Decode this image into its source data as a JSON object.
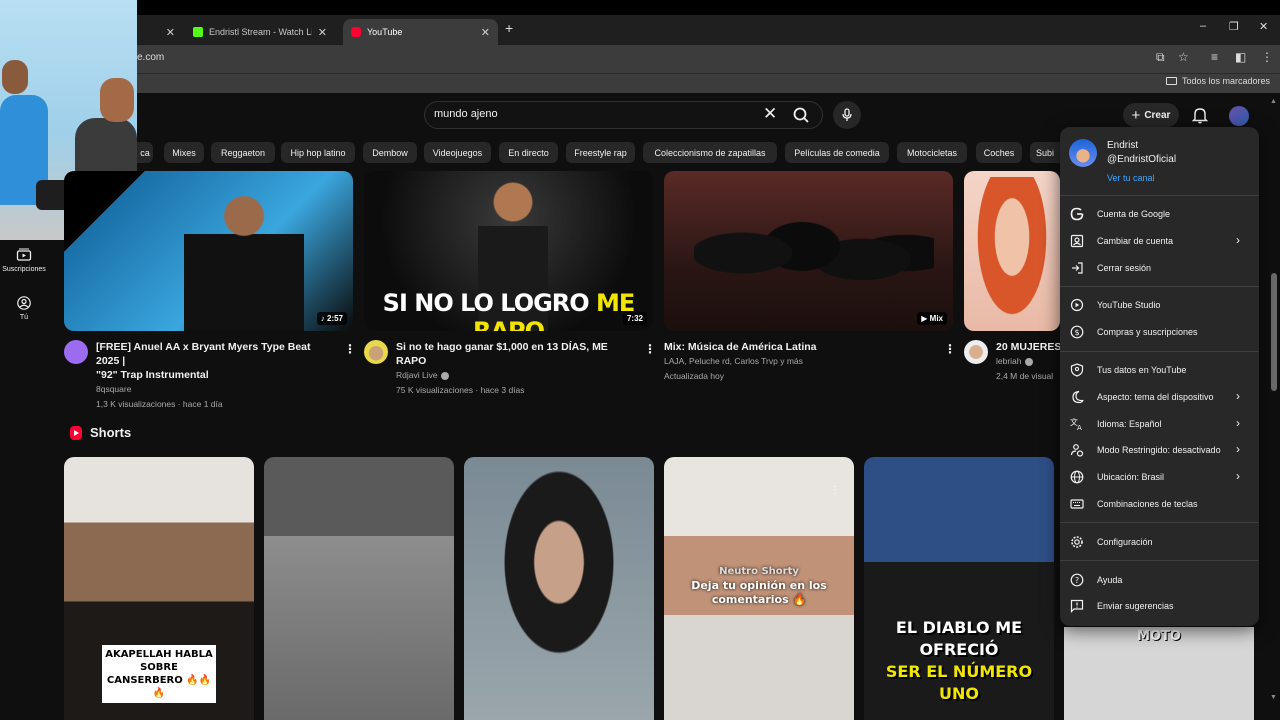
{
  "browser": {
    "tabs": [
      {
        "title": "",
        "active": false
      },
      {
        "title": "Endristl Stream - Watch Live on",
        "active": false
      },
      {
        "title": "YouTube",
        "active": true
      }
    ],
    "new_tab_label": "+",
    "url": "e.com",
    "bookmarks_label": "Todos los marcadores"
  },
  "header": {
    "search_query": "mundo ajeno",
    "create_label": "Crear"
  },
  "chips": [
    "ca",
    "Mixes",
    "Reggaeton",
    "Hip hop latino",
    "Dembow",
    "Videojuegos",
    "En directo",
    "Freestyle rap",
    "Coleccionismo de zapatillas",
    "Películas de comedia",
    "Motocicletas",
    "Coches",
    "Subi"
  ],
  "left_nav": [
    {
      "label": "Suscripciones",
      "icon": "subscriptions-icon"
    },
    {
      "label": "Tú",
      "icon": "you-icon"
    }
  ],
  "videos": [
    {
      "title_line1": "[FREE] Anuel AA x Bryant Myers Type Beat 2025 |",
      "title_line2": "\"92\" Trap Instrumental",
      "channel": "8qsquare",
      "stats": "1,3 K visualizaciones · hace 1 día",
      "badge": "♪ 2:57",
      "avatar_color": "#9b6cf0"
    },
    {
      "title_line1": "Si no te hago ganar $1,000 en 13 DÍAS, ME RAPO",
      "title_line2": "",
      "channel": "Rdjavi Live",
      "stats": "75 K visualizaciones · hace 3 días",
      "badge": "7:32",
      "thumb_caption_white": "SI NO LO LOGRO",
      "thumb_caption_yellow": "ME RAPO"
    },
    {
      "title_line1": "Mix: Música de América Latina",
      "title_line2": "",
      "channel": "LAJA, Peluche rd, Carlos Trvp y más",
      "stats": "Actualizada hoy",
      "badge": "▶ Mix"
    },
    {
      "title_line1": "20 MUJERES",
      "title_line2": "",
      "channel": "lebriah",
      "stats": "2,4 M de visual",
      "badge": ""
    }
  ],
  "shorts": {
    "title": "Shorts",
    "items": [
      {
        "caption": "AKAPELLAH HABLA SOBRE CANSERBERO 🔥🔥🔥"
      },
      {
        "caption": ""
      },
      {
        "caption": ""
      },
      {
        "caption_top": "Neutro Shorty",
        "caption": "Deja tu opinión en los comentarios 🔥"
      },
      {
        "caption": "EL DIABLO ME OFRECIÓ",
        "caption_yellow": "SER EL NÚMERO UNO"
      },
      {
        "caption": "MOTO"
      }
    ]
  },
  "account_menu": {
    "name": "Endrist",
    "handle": "@EndristOficial",
    "channel_link": "Ver tu canal",
    "sections": [
      [
        {
          "label": "Cuenta de Google",
          "icon": "google-icon",
          "chevron": false
        },
        {
          "label": "Cambiar de cuenta",
          "icon": "switch-account-icon",
          "chevron": true
        },
        {
          "label": "Cerrar sesión",
          "icon": "sign-out-icon",
          "chevron": false
        }
      ],
      [
        {
          "label": "YouTube Studio",
          "icon": "studio-icon",
          "chevron": false
        },
        {
          "label": "Compras y suscripciones",
          "icon": "dollar-icon",
          "chevron": false
        }
      ],
      [
        {
          "label": "Tus datos en YouTube",
          "icon": "shield-user-icon",
          "chevron": false
        },
        {
          "label": "Aspecto: tema del dispositivo",
          "icon": "moon-icon",
          "chevron": true
        },
        {
          "label": "Idioma: Español",
          "icon": "translate-icon",
          "chevron": true
        },
        {
          "label": "Modo Restringido: desactivado",
          "icon": "restricted-icon",
          "chevron": true
        },
        {
          "label": "Ubicación: Brasil",
          "icon": "globe-icon",
          "chevron": true
        },
        {
          "label": "Combinaciones de teclas",
          "icon": "keyboard-icon",
          "chevron": false
        }
      ],
      [
        {
          "label": "Configuración",
          "icon": "gear-icon",
          "chevron": false
        }
      ],
      [
        {
          "label": "Ayuda",
          "icon": "help-icon",
          "chevron": false
        },
        {
          "label": "Enviar sugerencias",
          "icon": "feedback-icon",
          "chevron": false
        }
      ]
    ]
  },
  "colors": {
    "accent": "#3ea6ff",
    "brand": "#ff0033",
    "yellow_caption": "#f2e600"
  }
}
